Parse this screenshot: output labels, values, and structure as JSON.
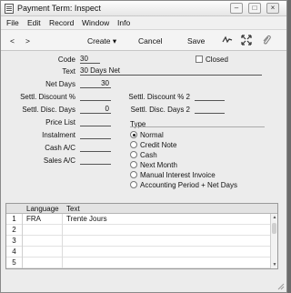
{
  "window": {
    "title": "Payment Term: Inspect"
  },
  "menu": [
    "File",
    "Edit",
    "Record",
    "Window",
    "Info"
  ],
  "toolbar": {
    "prev": "<",
    "next": ">",
    "create": "Create",
    "create_caret": "▾",
    "cancel": "Cancel",
    "save": "Save"
  },
  "form": {
    "code_label": "Code",
    "code_value": "30",
    "closed_label": "Closed",
    "text_label": "Text",
    "text_value": "30 Days Net",
    "net_days_label": "Net Days",
    "net_days_value": "30",
    "settl_disc_label": "Settl. Discount %",
    "settl_disc_value": "",
    "settl_disc2_label": "Settl. Discount % 2",
    "settl_disc2_value": "",
    "settl_days_label": "Settl. Disc. Days",
    "settl_days_value": "0",
    "settl_days2_label": "Settl. Disc. Days 2",
    "settl_days2_value": "",
    "price_list_label": "Price List",
    "price_list_value": "",
    "instalment_label": "Instalment",
    "instalment_value": "",
    "cash_ac_label": "Cash A/C",
    "cash_ac_value": "",
    "sales_ac_label": "Sales A/C",
    "sales_ac_value": ""
  },
  "type": {
    "label": "Type",
    "selected": "Normal",
    "options": [
      "Normal",
      "Credit Note",
      "Cash",
      "Next Month",
      "Manual Interest Invoice",
      "Accounting Period + Net Days"
    ]
  },
  "grid": {
    "headers": [
      "Language",
      "Text"
    ],
    "rows": [
      {
        "n": "1",
        "language": "FRA",
        "text": "Trente Jours"
      },
      {
        "n": "2",
        "language": "",
        "text": ""
      },
      {
        "n": "3",
        "language": "",
        "text": ""
      },
      {
        "n": "4",
        "language": "",
        "text": ""
      },
      {
        "n": "5",
        "language": "",
        "text": ""
      }
    ]
  }
}
